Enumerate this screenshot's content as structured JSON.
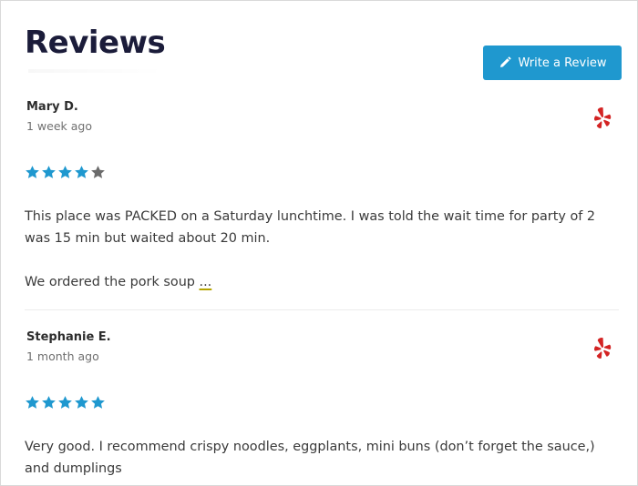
{
  "header": {
    "title": "Reviews",
    "write_button_label": "Write a Review",
    "write_button_icon": "pencil-icon",
    "accent_color": "#1f98cf"
  },
  "reviews": [
    {
      "author": "Mary D.",
      "date": "1 week ago",
      "rating": 4,
      "max_rating": 5,
      "source_icon": "yelp-icon",
      "paragraphs": [
        "This place was PACKED on a Saturday lunchtime. I was told the wait time for party of 2 was 15 min but waited about 20 min.",
        "We ordered the pork soup"
      ],
      "more_label": "..."
    },
    {
      "author": "Stephanie E.",
      "date": "1 month ago",
      "rating": 5,
      "max_rating": 5,
      "source_icon": "yelp-icon",
      "paragraphs": [
        "Very good. I recommend crispy noodles, eggplants, mini buns (don’t forget the sauce,) and dumplings"
      ]
    }
  ],
  "colors": {
    "star_filled": "#1f98cf",
    "star_empty": "#6b6b6b",
    "yelp_red": "#d32323",
    "title": "#1b1c3a"
  }
}
